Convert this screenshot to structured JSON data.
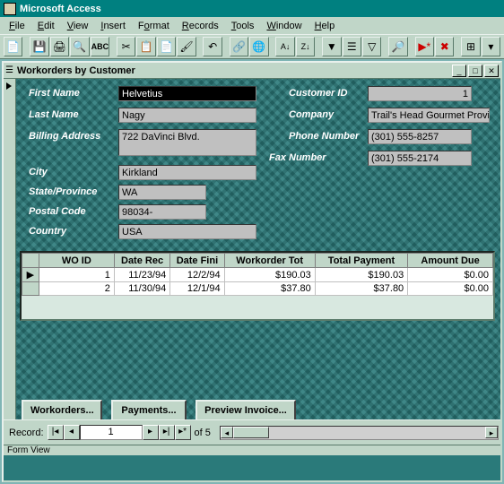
{
  "app": {
    "title": "Microsoft Access"
  },
  "menu": [
    "File",
    "Edit",
    "View",
    "Insert",
    "Format",
    "Records",
    "Tools",
    "Window",
    "Help"
  ],
  "form": {
    "title": "Workorders by Customer",
    "labels": {
      "first_name": "First Name",
      "last_name": "Last Name",
      "billing": "Billing Address",
      "city": "City",
      "state": "State/Province",
      "postal": "Postal Code",
      "country": "Country",
      "cust_id": "Customer ID",
      "company": "Company",
      "phone": "Phone Number",
      "fax": "Fax Number"
    },
    "values": {
      "first_name": "Helvetius",
      "last_name": "Nagy",
      "billing": "722 DaVinci Blvd.",
      "city": "Kirkland",
      "state": "WA",
      "postal": "98034-",
      "country": "USA",
      "cust_id": "1",
      "company": "Trail's Head Gourmet Provis",
      "phone": "(301) 555-8257",
      "fax": "(301) 555-2174"
    }
  },
  "grid": {
    "headers": [
      "WO ID",
      "Date Rec",
      "Date Fini",
      "Workorder Tot",
      "Total Payment",
      "Amount Due"
    ],
    "rows": [
      {
        "id": "1",
        "rec": "11/23/94",
        "fin": "12/2/94",
        "tot": "$190.03",
        "pay": "$190.03",
        "due": "$0.00"
      },
      {
        "id": "2",
        "rec": "11/30/94",
        "fin": "12/1/94",
        "tot": "$37.80",
        "pay": "$37.80",
        "due": "$0.00"
      }
    ]
  },
  "buttons": {
    "wo": "Workorders...",
    "pay": "Payments...",
    "preview": "Preview Invoice..."
  },
  "nav": {
    "label": "Record:",
    "current": "1",
    "of": "of  5"
  },
  "status": "Form View"
}
